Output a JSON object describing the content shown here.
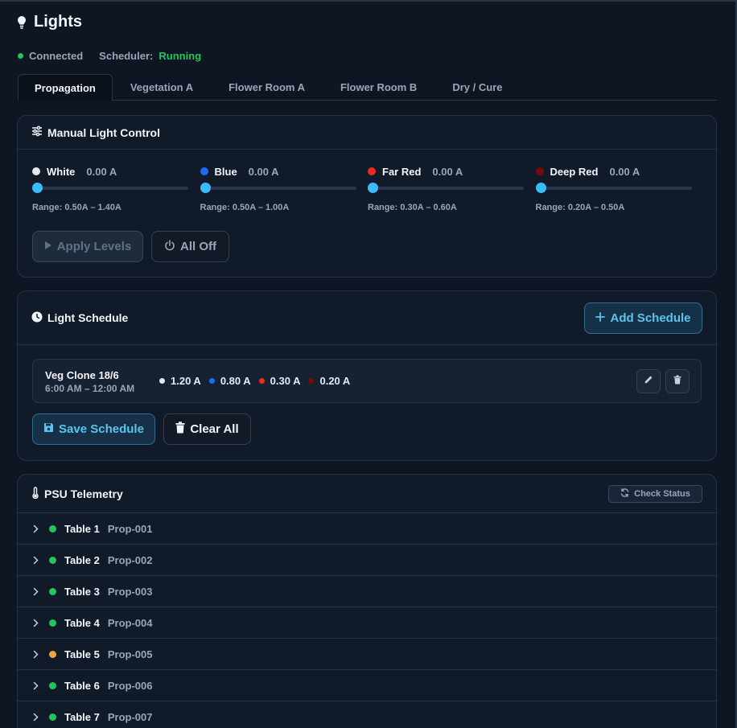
{
  "page": {
    "title": "Lights"
  },
  "status": {
    "connection": "Connected",
    "scheduler_label": "Scheduler:",
    "scheduler_value": "Running"
  },
  "tabs": [
    {
      "label": "Propagation",
      "active": true
    },
    {
      "label": "Vegetation A",
      "active": false
    },
    {
      "label": "Flower Room A",
      "active": false
    },
    {
      "label": "Flower Room B",
      "active": false
    },
    {
      "label": "Dry / Cure",
      "active": false
    }
  ],
  "manual": {
    "title": "Manual Light Control",
    "channels": [
      {
        "name": "White",
        "value": "0.00 A",
        "range": "Range: 0.50A – 1.40A",
        "color": "#e5e7eb"
      },
      {
        "name": "Blue",
        "value": "0.00 A",
        "range": "Range: 0.50A – 1.00A",
        "color": "#1d6cf5"
      },
      {
        "name": "Far Red",
        "value": "0.00 A",
        "range": "Range: 0.30A – 0.60A",
        "color": "#ef2b1f"
      },
      {
        "name": "Deep Red",
        "value": "0.00 A",
        "range": "Range: 0.20A – 0.50A",
        "color": "#7a0a0a"
      }
    ],
    "apply_label": "Apply Levels",
    "off_label": "All Off"
  },
  "schedule": {
    "title": "Light Schedule",
    "add_label": "Add Schedule",
    "entries": [
      {
        "name": "Veg Clone 18/6",
        "time": "6:00 AM – 12:00 AM",
        "levels": [
          {
            "value": "1.20 A",
            "color": "#e5e7eb"
          },
          {
            "value": "0.80 A",
            "color": "#1d6cf5"
          },
          {
            "value": "0.30 A",
            "color": "#ef2b1f"
          },
          {
            "value": "0.20 A",
            "color": "#7a0a0a"
          }
        ]
      }
    ],
    "save_label": "Save Schedule",
    "clear_label": "Clear All"
  },
  "psu": {
    "title": "PSU Telemetry",
    "check_label": "Check Status",
    "rows": [
      {
        "name": "Table 1",
        "id": "Prop-001",
        "status_color": "#22c55e"
      },
      {
        "name": "Table 2",
        "id": "Prop-002",
        "status_color": "#22c55e"
      },
      {
        "name": "Table 3",
        "id": "Prop-003",
        "status_color": "#22c55e"
      },
      {
        "name": "Table 4",
        "id": "Prop-004",
        "status_color": "#22c55e"
      },
      {
        "name": "Table 5",
        "id": "Prop-005",
        "status_color": "#f5a340"
      },
      {
        "name": "Table 6",
        "id": "Prop-006",
        "status_color": "#22c55e"
      },
      {
        "name": "Table 7",
        "id": "Prop-007",
        "status_color": "#22c55e"
      }
    ]
  }
}
